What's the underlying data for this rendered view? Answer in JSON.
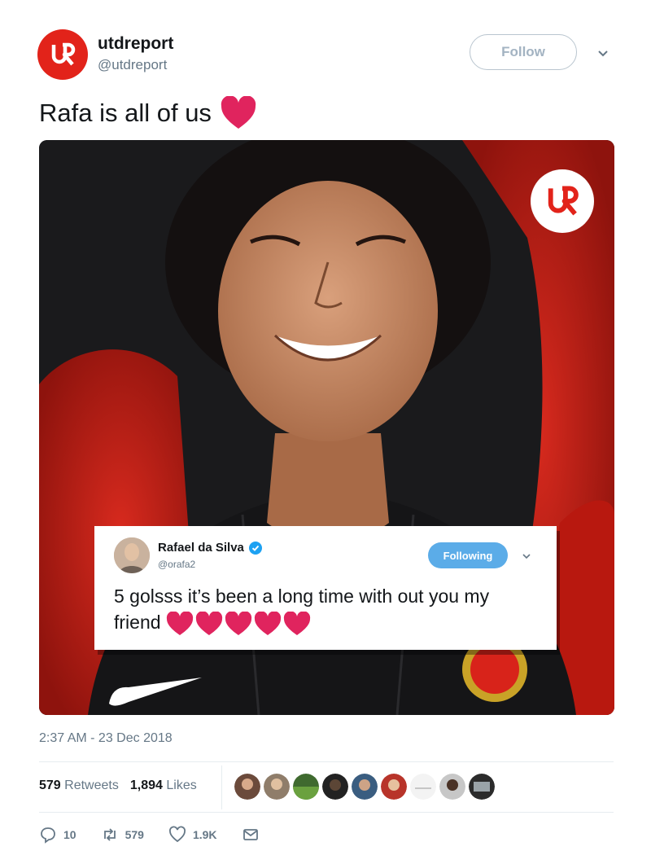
{
  "account": {
    "display_name": "utdreport",
    "handle": "@utdreport",
    "follow_label": "Follow",
    "brand_color": "#e2231a"
  },
  "tweet": {
    "text": "Rafa is all of us",
    "emoji": "red-heart"
  },
  "embedded_tweet": {
    "display_name": "Rafael da Silva",
    "handle": "@orafa2",
    "following_label": "Following",
    "text": "5 golsss it’s been a long time with out you my friend",
    "hearts_count": 5
  },
  "meta": {
    "timestamp": "2:37 AM - 23 Dec 2018",
    "retweets_count": "579",
    "retweets_label": "Retweets",
    "likes_count": "1,894",
    "likes_label": "Likes"
  },
  "actions": {
    "replies": "10",
    "retweets": "579",
    "likes": "1.9K"
  },
  "colors": {
    "text_primary": "#14171a",
    "text_secondary": "#657786",
    "accent_blue": "#5bace8",
    "heart_red": "#e0245e"
  }
}
